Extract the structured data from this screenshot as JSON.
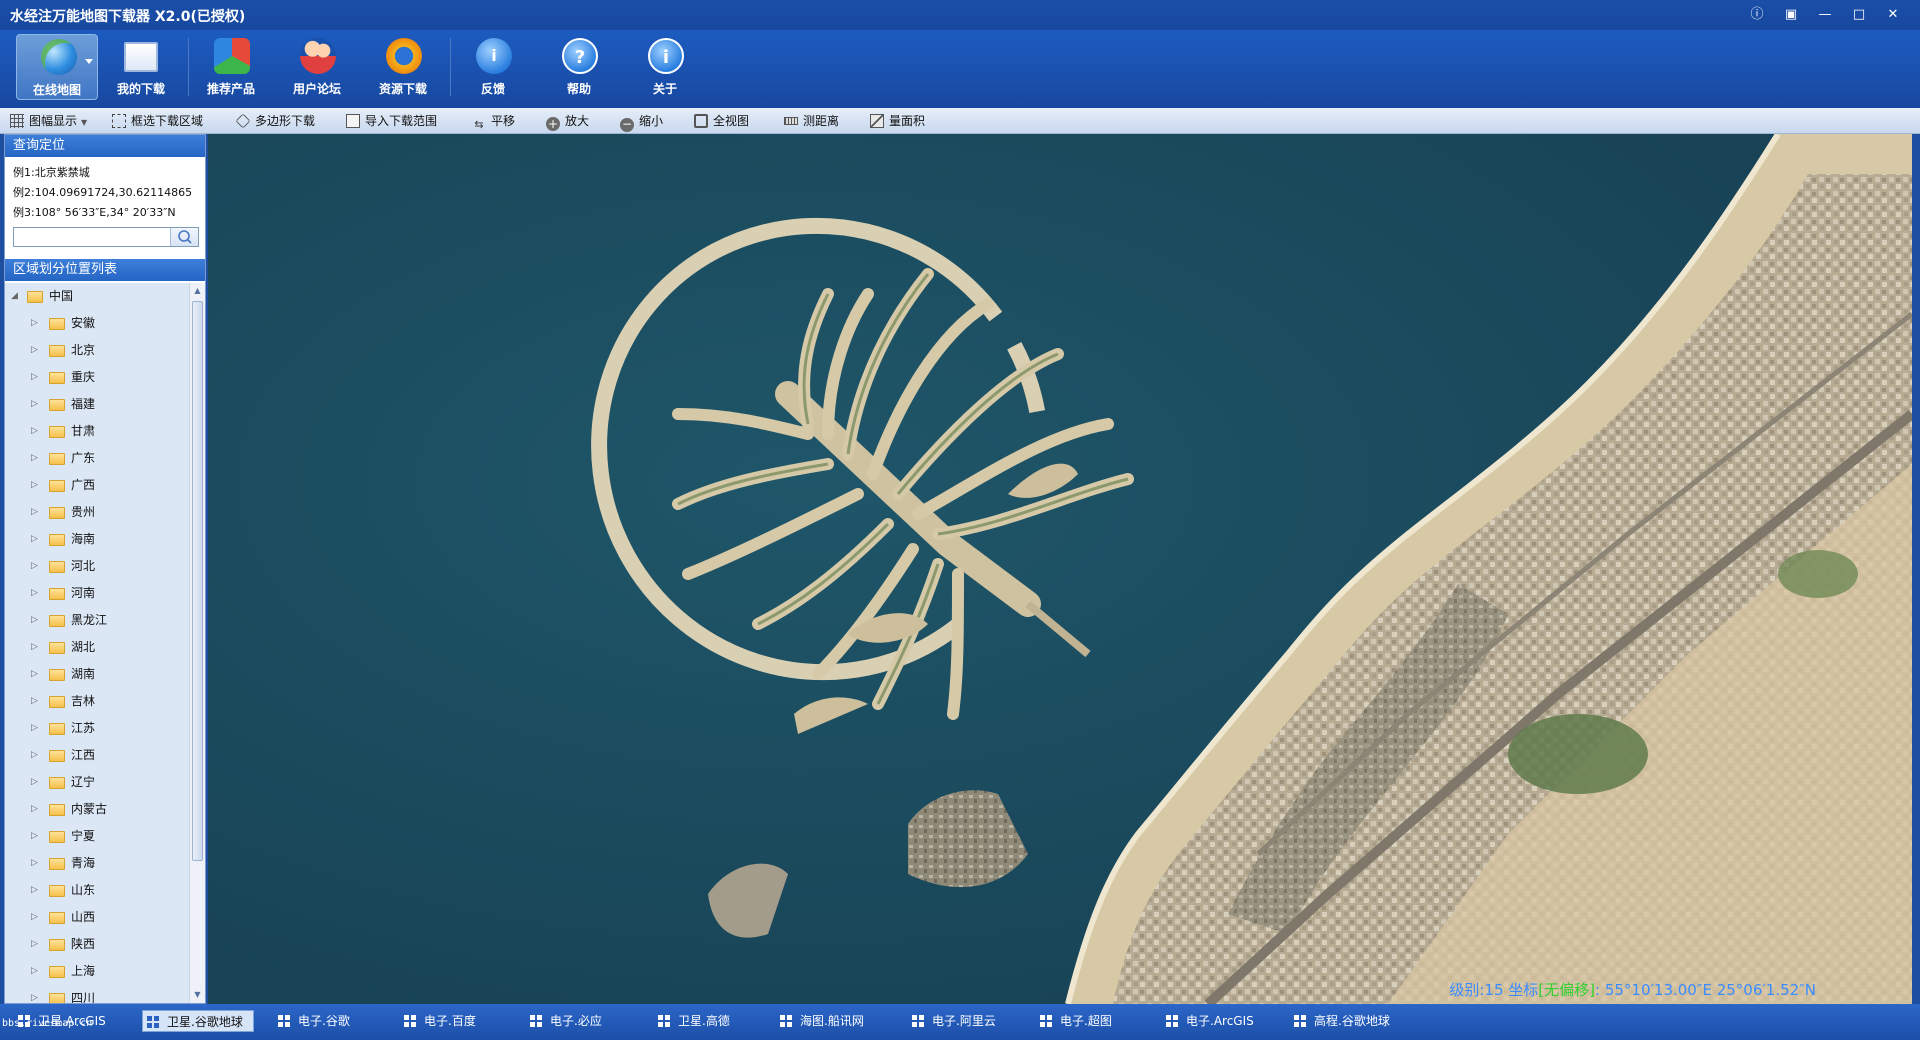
{
  "window": {
    "title": "水经注万能地图下载器 X2.0(已授权)"
  },
  "ribbon": {
    "buttons": [
      {
        "label": "在线地图",
        "icon": "globe-icon",
        "active": true
      },
      {
        "label": "我的下载",
        "icon": "downloads-icon"
      },
      {
        "label": "推荐产品",
        "icon": "products-icon"
      },
      {
        "label": "用户论坛",
        "icon": "forum-icon"
      },
      {
        "label": "资源下载",
        "icon": "resource-icon"
      },
      {
        "label": "反馈",
        "icon": "feedback-icon"
      },
      {
        "label": "帮助",
        "icon": "help-icon"
      },
      {
        "label": "关于",
        "icon": "about-icon"
      }
    ]
  },
  "toolbar": {
    "items": [
      {
        "label": "图幅显示",
        "icon": "grid-icon"
      },
      {
        "label": "框选下载区域",
        "icon": "select-rect-icon"
      },
      {
        "label": "多边形下载",
        "icon": "polygon-icon"
      },
      {
        "label": "导入下载范围",
        "icon": "import-icon"
      },
      {
        "label": "平移",
        "icon": "pan-icon"
      },
      {
        "label": "放大",
        "icon": "zoom-in-icon"
      },
      {
        "label": "缩小",
        "icon": "zoom-out-icon"
      },
      {
        "label": "全视图",
        "icon": "full-view-icon"
      },
      {
        "label": "测距离",
        "icon": "ruler-icon"
      },
      {
        "label": "量面积",
        "icon": "area-icon"
      }
    ]
  },
  "sidebar": {
    "query_title": "查询定位",
    "examples": [
      "例1:北京紫禁城",
      "例2:104.09691724,30.62114865",
      "例3:108° 56′33″E,34° 20′33″N"
    ],
    "search": {
      "value": "",
      "placeholder": ""
    },
    "region_title": "区域划分位置列表",
    "root": "中国",
    "provinces": [
      "安徽",
      "北京",
      "重庆",
      "福建",
      "甘肃",
      "广东",
      "广西",
      "贵州",
      "海南",
      "河北",
      "河南",
      "黑龙江",
      "湖北",
      "湖南",
      "吉林",
      "江苏",
      "江西",
      "辽宁",
      "内蒙古",
      "宁夏",
      "青海",
      "山东",
      "山西",
      "陕西",
      "上海",
      "四川"
    ]
  },
  "map": {
    "status_prefix": "级别:15 坐标",
    "status_flag": "[无偏移]",
    "status_coords": ":  55°10′13.00″E    25°06′1.52″N"
  },
  "bottom_tabs": [
    {
      "label": "卫星.ArcGIS"
    },
    {
      "label": "卫星.谷歌地球",
      "active": true
    },
    {
      "label": "电子.谷歌"
    },
    {
      "label": "电子.百度"
    },
    {
      "label": "电子.必应"
    },
    {
      "label": "卫星.高德"
    },
    {
      "label": "海图.船讯网"
    },
    {
      "label": "电子.阿里云"
    },
    {
      "label": "电子.超图"
    },
    {
      "label": "电子.ArcGIS"
    },
    {
      "label": "高程.谷歌地球"
    }
  ],
  "watermark": "bbs.rivermap.cn"
}
